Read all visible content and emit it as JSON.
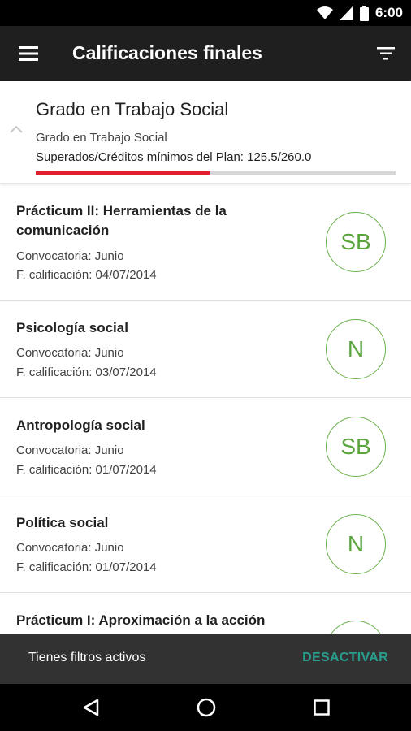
{
  "status_bar": {
    "time": "6:00",
    "icons": [
      "wifi-icon",
      "signal-icon",
      "battery-icon"
    ]
  },
  "app_bar": {
    "title": "Calificaciones finales",
    "menu_icon": "hamburger-menu-icon",
    "filter_icon": "filter-icon"
  },
  "degree": {
    "title": "Grado en Trabajo Social",
    "subtitle": "Grado en Trabajo Social",
    "credits_text": "Superados/Créditos mínimos del Plan: 125.5/260.0",
    "progress_fraction": 0.483,
    "progress_color": "#e0202e"
  },
  "subjects": [
    {
      "name": "Prácticum II: Herramientas de la comunicación",
      "convocatoria": "Convocatoria: Junio",
      "fecha": "F. calificación: 04/07/2014",
      "grade": "SB"
    },
    {
      "name": "Psicología social",
      "convocatoria": "Convocatoria: Junio",
      "fecha": "F. calificación: 03/07/2014",
      "grade": "N"
    },
    {
      "name": "Antropología social",
      "convocatoria": "Convocatoria: Junio",
      "fecha": "F. calificación: 01/07/2014",
      "grade": "SB"
    },
    {
      "name": "Política social",
      "convocatoria": "Convocatoria: Junio",
      "fecha": "F. calificación: 01/07/2014",
      "grade": "N"
    },
    {
      "name": "Prácticum I: Aproximación a la acción",
      "convocatoria": "",
      "fecha": "",
      "grade": ""
    }
  ],
  "snackbar": {
    "text": "Tienes filtros activos",
    "action": "DESACTIVAR",
    "action_color": "#2a9d8f"
  },
  "colors": {
    "app_bar": "#1f1f1f",
    "grade_green": "#5aa53c"
  }
}
